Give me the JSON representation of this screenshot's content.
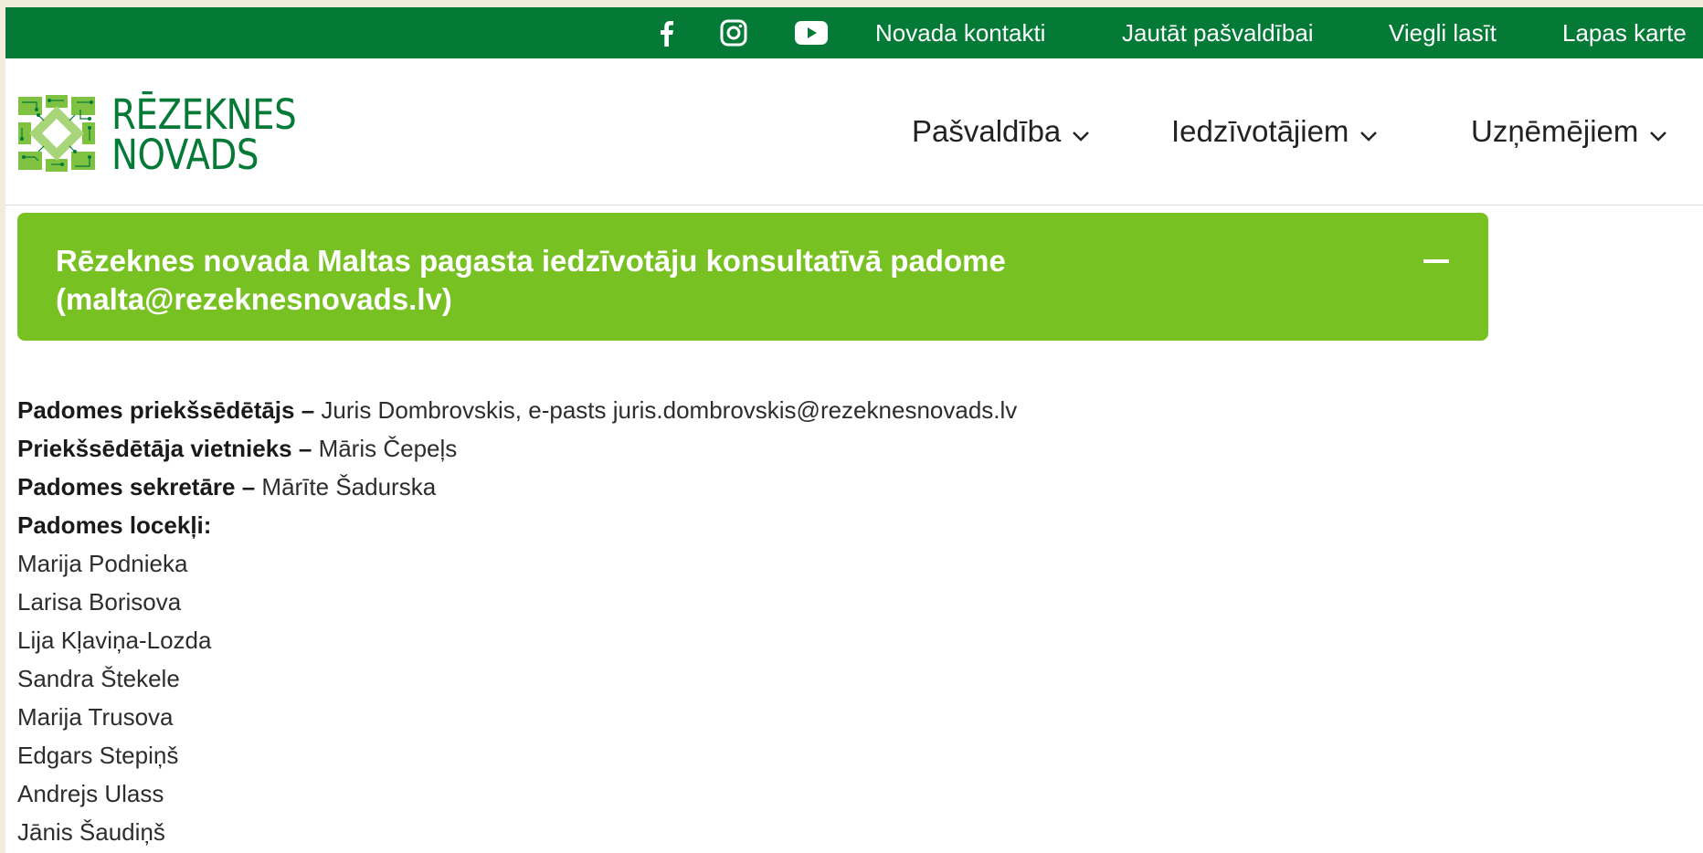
{
  "topbar": {
    "social": [
      "facebook-icon",
      "instagram-icon",
      "youtube-icon"
    ],
    "links": [
      "Novada kontakti",
      "Jautāt pašvaldībai",
      "Viegli lasīt",
      "Lapas karte"
    ]
  },
  "header": {
    "logo": {
      "line1": "RĒZEKNES",
      "line2": "NOVADS"
    },
    "nav": [
      {
        "label": "Pašvaldība",
        "icon": "chevron-down-icon"
      },
      {
        "label": "Iedzīvotājiem",
        "icon": "chevron-down-icon"
      },
      {
        "label": "Uzņēmējiem",
        "icon": "chevron-down-icon"
      }
    ]
  },
  "accordion": {
    "title": "Rēzeknes novada Maltas pagasta iedzīvotāju konsultatīvā padome (malta@rezeknesnovads.lv)",
    "toggle_icon": "minus-icon",
    "state": "expanded"
  },
  "council": {
    "chair_label": "Padomes priekšsēdētājs –",
    "chair_value": "Juris Dombrovskis, e-pasts juris.dombrovskis@rezeknesnovads.lv",
    "deputy_label": "Priekšsēdētāja vietnieks –",
    "deputy_value": "Māris Čepeļs",
    "secretary_label": "Padomes sekretāre –",
    "secretary_value": "Mārīte Šadurska",
    "members_label": "Padomes locekļi:",
    "members": [
      "Marija Podnieka",
      "Larisa Borisova",
      "Lija Kļaviņa-Lozda",
      "Sandra Štekele",
      "Marija Trusova",
      "Edgars Stepiņš",
      "Andrejs Ulass",
      "Jānis Šaudiņš"
    ]
  },
  "colors": {
    "topbar": "#047a36",
    "brand_green": "#047a36",
    "accordion": "#78c122",
    "text": "#2d2d2d"
  }
}
